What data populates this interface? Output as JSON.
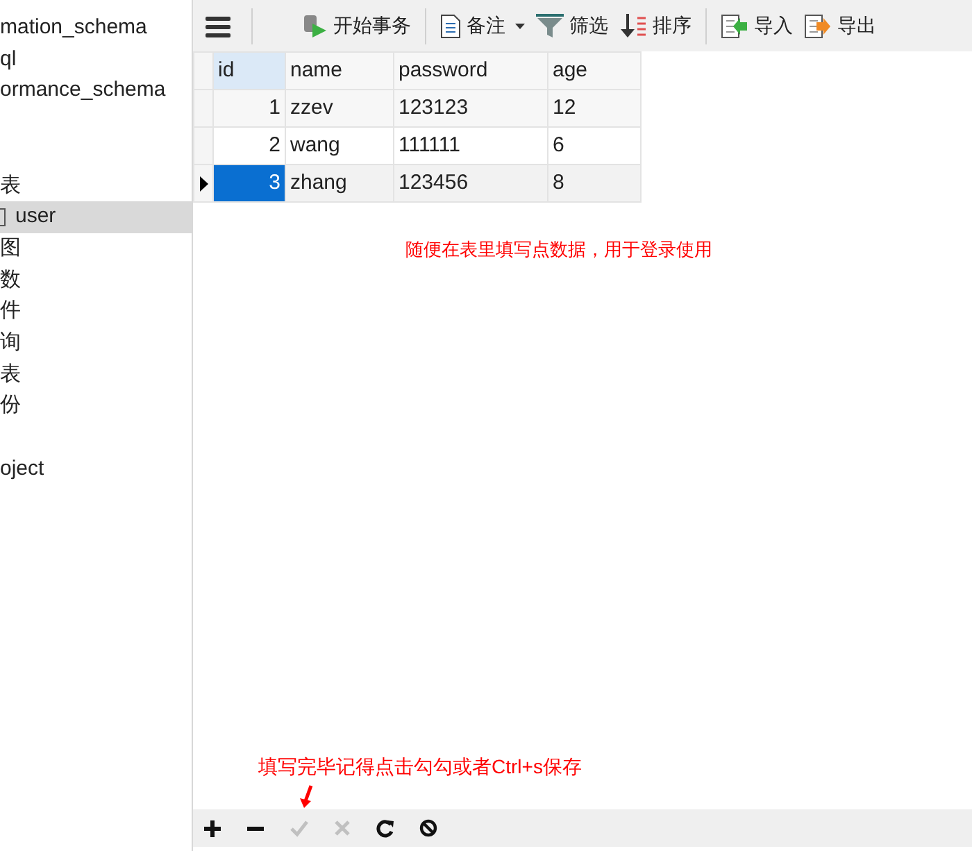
{
  "sidebar": {
    "groups": [
      {
        "items": [
          {
            "label": "mation_schema",
            "selected": false
          },
          {
            "label": "ql",
            "selected": false
          },
          {
            "label": "ormance_schema",
            "selected": false
          }
        ]
      },
      {
        "items": [
          {
            "label": "表",
            "selected": false
          },
          {
            "label": "user",
            "selected": true
          },
          {
            "label": "图",
            "selected": false
          },
          {
            "label": "数",
            "selected": false
          },
          {
            "label": "件",
            "selected": false
          },
          {
            "label": "询",
            "selected": false
          },
          {
            "label": "表",
            "selected": false
          },
          {
            "label": "份",
            "selected": false
          }
        ]
      },
      {
        "items": [
          {
            "label": "oject",
            "selected": false
          }
        ]
      }
    ]
  },
  "toolbar": [
    {
      "kind": "menu"
    },
    {
      "kind": "transaction",
      "label": "开始事务"
    },
    {
      "kind": "note",
      "label": "备注"
    },
    {
      "kind": "filter",
      "label": "筛选"
    },
    {
      "kind": "sort",
      "label": "排序"
    },
    {
      "kind": "import",
      "label": "导入"
    },
    {
      "kind": "export",
      "label": "导出"
    }
  ],
  "table": {
    "columns": [
      "id",
      "name",
      "password",
      "age"
    ],
    "rows": [
      {
        "cells": [
          "1",
          "zzev",
          "123123",
          "12"
        ],
        "selected": false
      },
      {
        "cells": [
          "2",
          "wang",
          "111111",
          "6"
        ],
        "selected": false
      },
      {
        "cells": [
          "3",
          "zhang",
          "123456",
          "8"
        ],
        "selected": true
      }
    ]
  },
  "annotations": [
    "随便在表里填写点数据，用于登录使用",
    "填写完毕记得点击勾勾或者Ctrl+s保存"
  ],
  "bottom_toolbar": [
    {
      "kind": "add",
      "disabled": false
    },
    {
      "kind": "delete",
      "disabled": false
    },
    {
      "kind": "apply",
      "disabled": true
    },
    {
      "kind": "discard",
      "disabled": true
    },
    {
      "kind": "refresh",
      "disabled": false
    },
    {
      "kind": "stop",
      "disabled": false
    }
  ]
}
